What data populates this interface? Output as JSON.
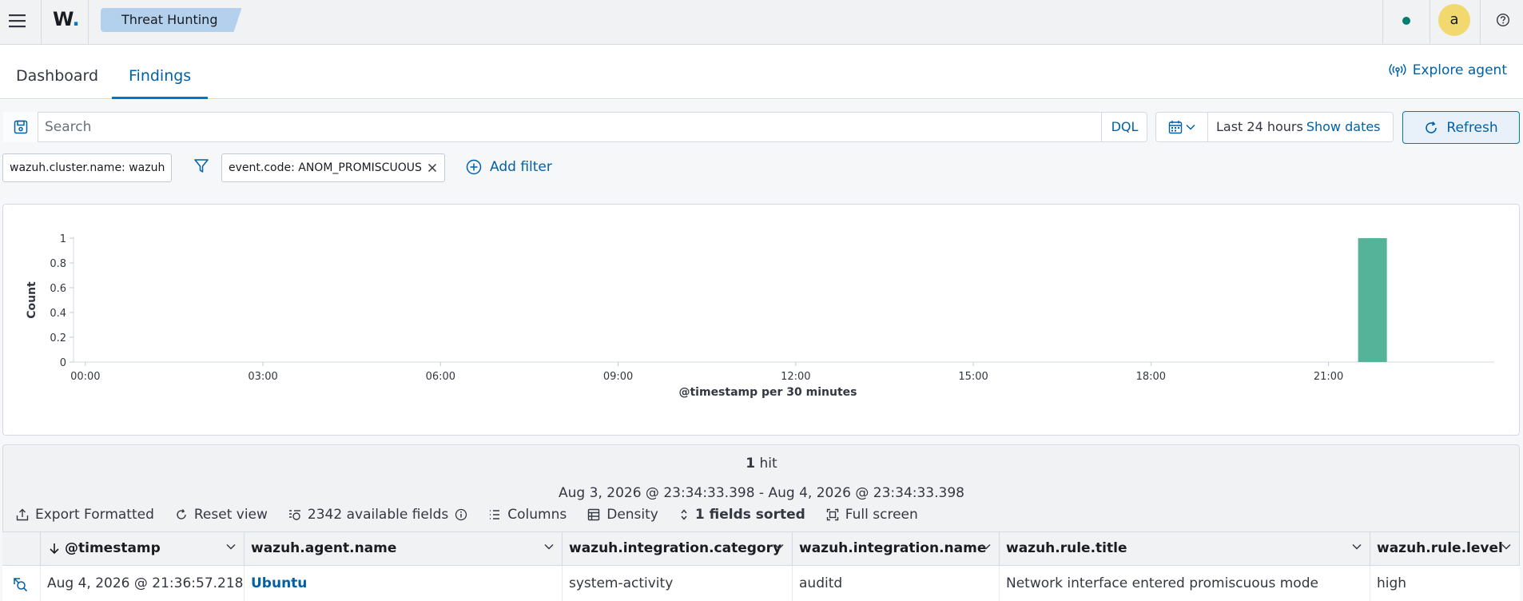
{
  "header": {
    "logo_text": "W",
    "logo_dot": ".",
    "breadcrumb": "Threat Hunting",
    "avatar_letter": "a",
    "status_color": "#017d73"
  },
  "tabs": [
    {
      "label": "Dashboard",
      "active": false
    },
    {
      "label": "Findings",
      "active": true
    }
  ],
  "explore_agent_label": "Explore agent",
  "search": {
    "placeholder": "Search",
    "language_label": "DQL"
  },
  "date_picker": {
    "range_label": "Last 24 hours",
    "show_dates_label": "Show dates"
  },
  "refresh_label": "Refresh",
  "filters": {
    "pinned": "wazuh.cluster.name: wazuh",
    "active": "event.code: ANOM_PROMISCUOUS",
    "add_label": "Add filter"
  },
  "chart_data": {
    "type": "bar",
    "xlabel": "@timestamp per 30 minutes",
    "ylabel": "Count",
    "ylim": [
      0,
      1
    ],
    "yticks": [
      "0",
      "0.2",
      "0.4",
      "0.6",
      "0.8",
      "1"
    ],
    "xticks": [
      "00:00",
      "03:00",
      "06:00",
      "09:00",
      "12:00",
      "15:00",
      "18:00",
      "21:00"
    ],
    "xrange_hours": [
      -0.2,
      23.8
    ],
    "bars": [
      {
        "start_hour": 21.5,
        "end_hour": 22.0,
        "value": 1
      }
    ],
    "bar_color": "#54b399",
    "grid": false
  },
  "results": {
    "hit_count": "1",
    "hit_label": "hit",
    "time_range": "Aug 3, 2026 @ 23:34:33.398 - Aug 4, 2026 @ 23:34:33.398",
    "toolbar": {
      "export": "Export Formatted",
      "reset": "Reset view",
      "fields": "2342 available fields",
      "columns": "Columns",
      "density": "Density",
      "sorted": "1 fields sorted",
      "fullscreen": "Full screen"
    },
    "columns": [
      "@timestamp",
      "wazuh.agent.name",
      "wazuh.integration.category",
      "wazuh.integration.name",
      "wazuh.rule.title",
      "wazuh.rule.level"
    ],
    "rows": [
      [
        "Aug 4, 2026 @ 21:36:57.218",
        "Ubuntu",
        "system-activity",
        "auditd",
        "Network interface entered promiscuous mode",
        "high"
      ]
    ]
  }
}
